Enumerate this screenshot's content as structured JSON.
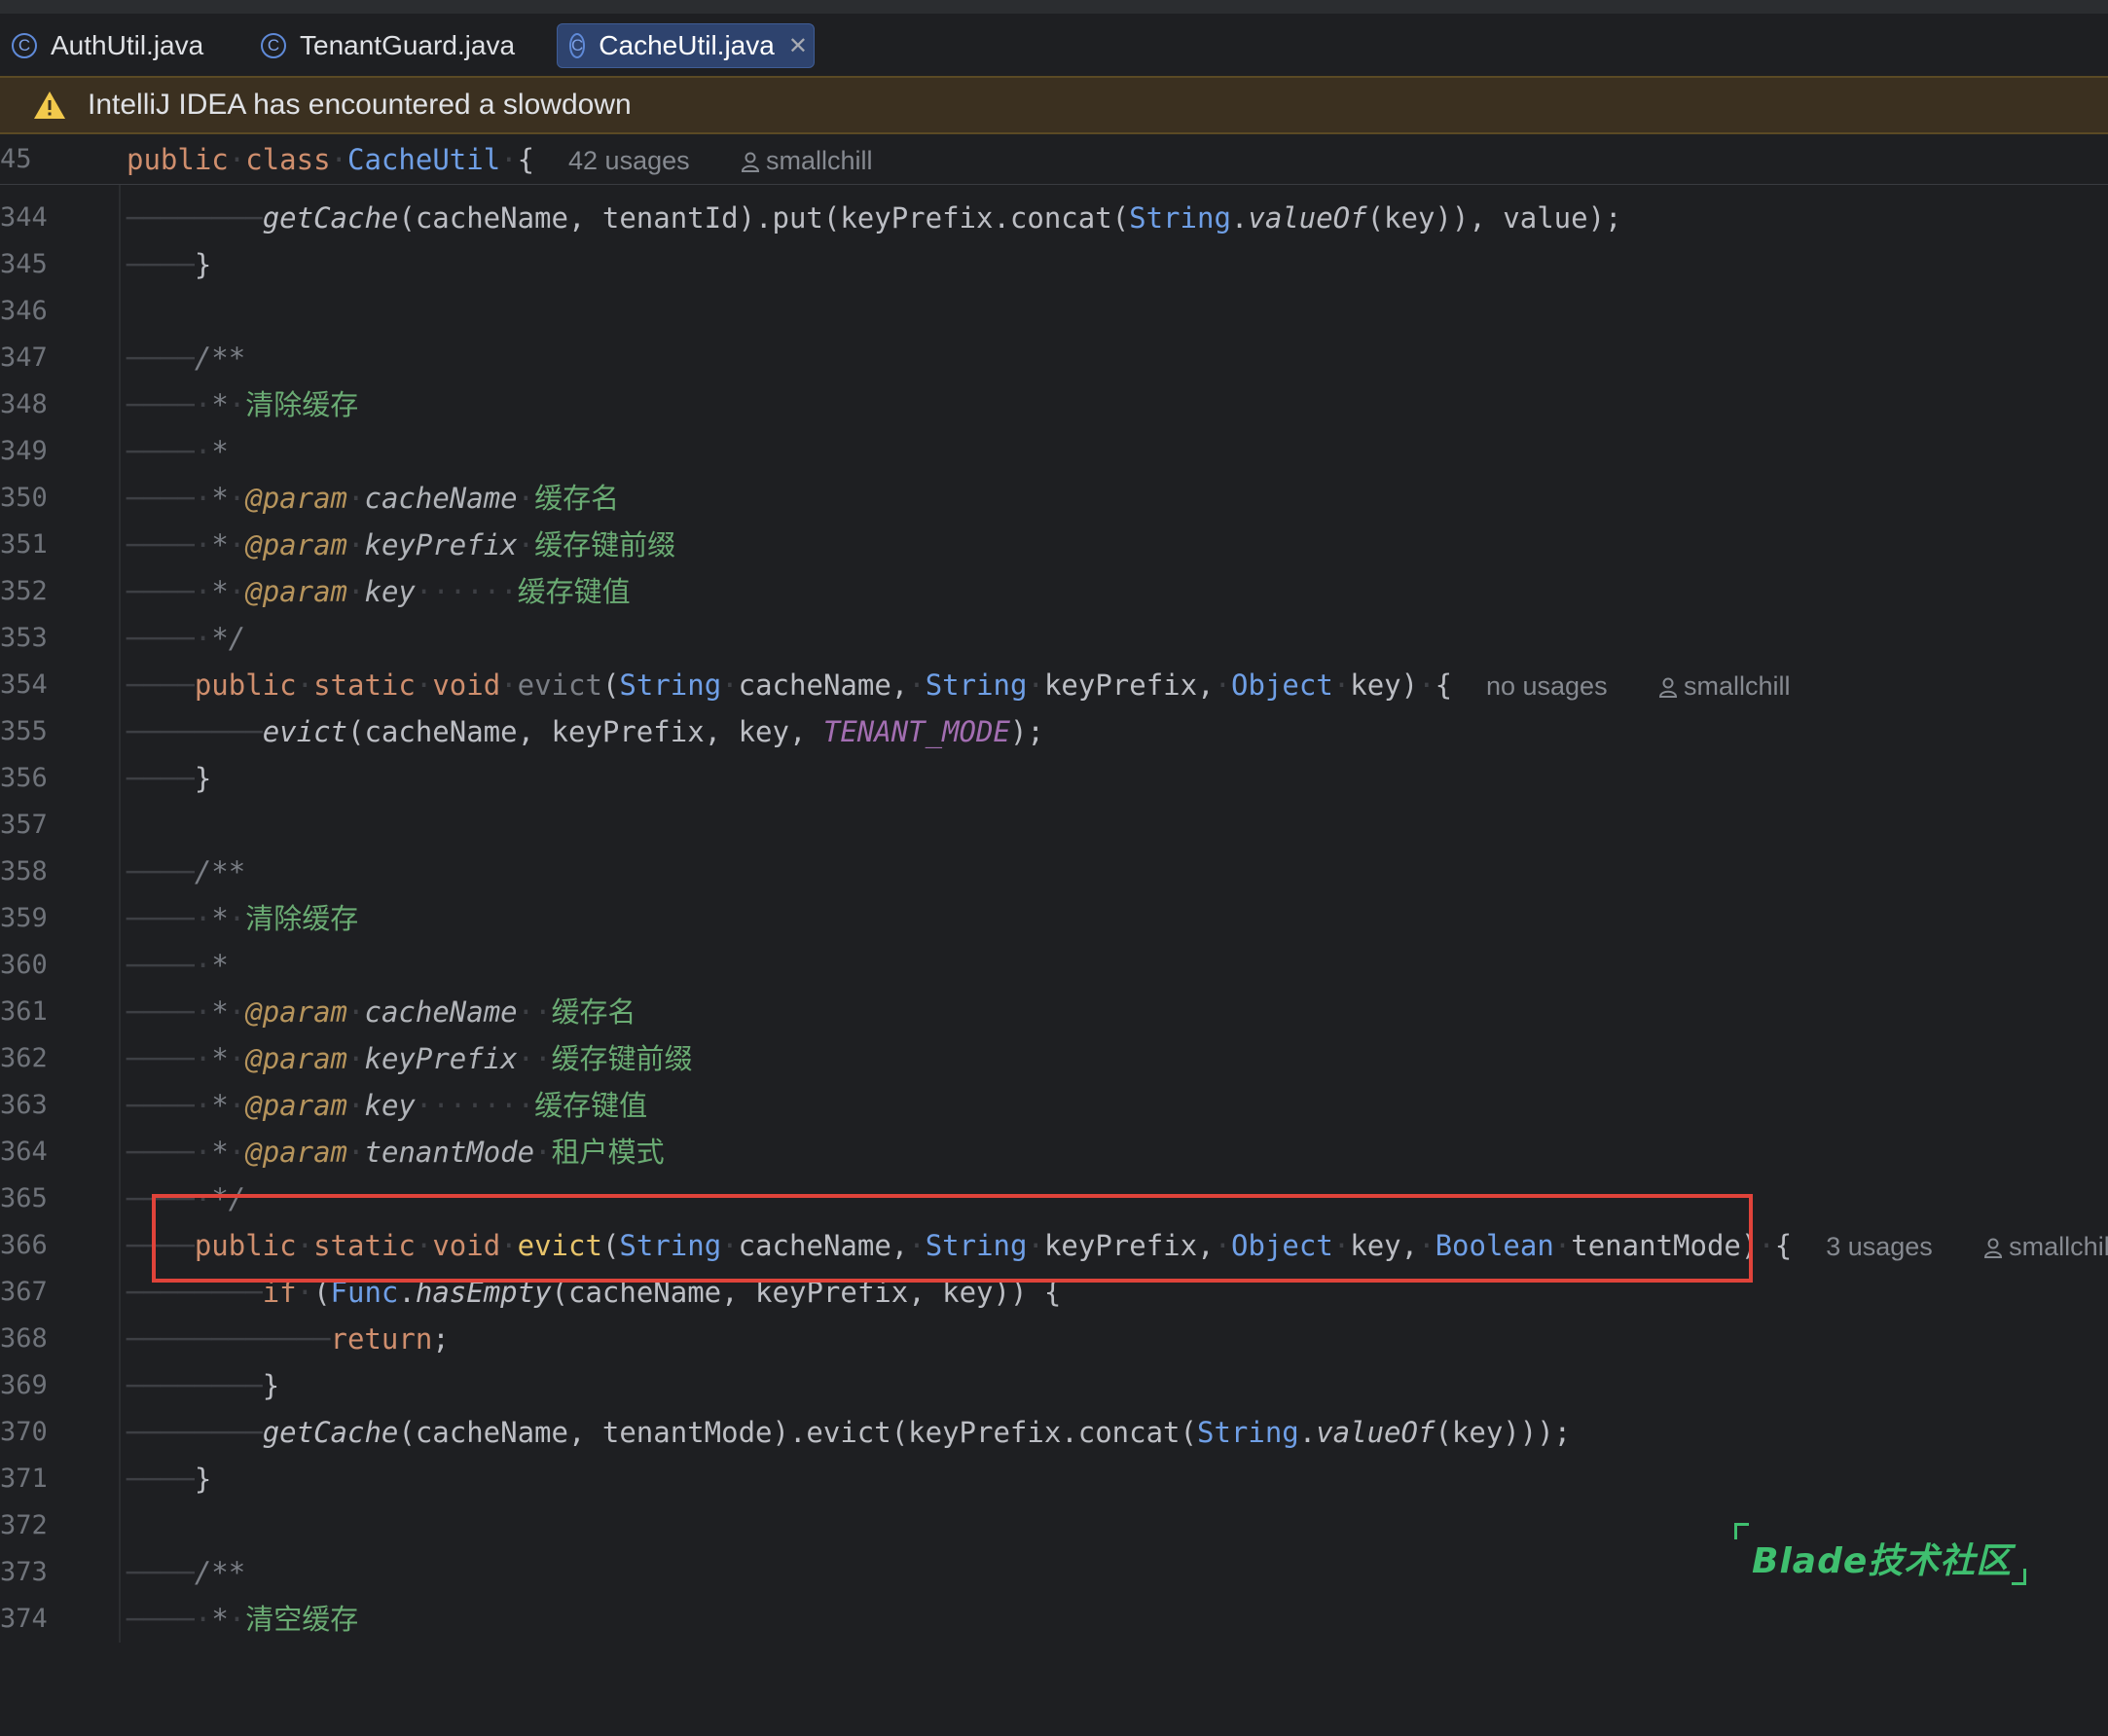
{
  "tabs": [
    {
      "label": "AuthUtil.java",
      "icon": "class-icon",
      "active": false
    },
    {
      "label": "TenantGuard.java",
      "icon": "class-icon",
      "active": false
    },
    {
      "label": "CacheUtil.java",
      "icon": "class-icon",
      "active": true
    }
  ],
  "banner": {
    "text": "IntelliJ IDEA has encountered a slowdown",
    "icon": "warning-icon"
  },
  "sticky": {
    "line_number": "45",
    "kw1": "public",
    "kw2": "class",
    "class_name": "CacheUtil",
    "brace": "{",
    "usages": "42 usages",
    "author": "smallchill"
  },
  "lines": {
    "l344": {
      "num": "344",
      "fn": "getCache",
      "a": "(cacheName, tenantId).put(keyPrefix.concat(",
      "type": "String",
      "dot": ".",
      "m": "valueOf",
      "b": "(key)), value);"
    },
    "l345": {
      "num": "345",
      "t": "}"
    },
    "l346": {
      "num": "346"
    },
    "l347": {
      "num": "347",
      "t": "/**"
    },
    "l348": {
      "num": "348",
      "star": "*",
      "t": "清除缓存"
    },
    "l349": {
      "num": "349",
      "star": "*"
    },
    "l350": {
      "num": "350",
      "star": "*",
      "tag": "@param",
      "p": "cacheName",
      "t": "缓存名"
    },
    "l351": {
      "num": "351",
      "star": "*",
      "tag": "@param",
      "p": "keyPrefix",
      "t": "缓存键前缀"
    },
    "l352": {
      "num": "352",
      "star": "*",
      "tag": "@param",
      "p": "key",
      "dots": "······",
      "t": "缓存键值"
    },
    "l353": {
      "num": "353",
      "t": "*/"
    },
    "l354": {
      "num": "354",
      "kw1": "public",
      "kw2": "static",
      "kw3": "void",
      "name": "evict",
      "open": "(",
      "ty1": "String",
      "p1": "cacheName,",
      "ty2": "String",
      "p2": "keyPrefix,",
      "ty3": "Object",
      "p3": "key)",
      "brace": "{",
      "usages": "no usages",
      "author": "smallchill"
    },
    "l355": {
      "num": "355",
      "fn": "evict",
      "a": "(cacheName, keyPrefix, key, ",
      "const": "TENANT_MODE",
      "b": ");"
    },
    "l356": {
      "num": "356",
      "t": "}"
    },
    "l357": {
      "num": "357"
    },
    "l358": {
      "num": "358",
      "t": "/**"
    },
    "l359": {
      "num": "359",
      "star": "*",
      "t": "清除缓存"
    },
    "l360": {
      "num": "360",
      "star": "*"
    },
    "l361": {
      "num": "361",
      "star": "*",
      "tag": "@param",
      "p": "cacheName",
      "t": "缓存名"
    },
    "l362": {
      "num": "362",
      "star": "*",
      "tag": "@param",
      "p": "keyPrefix",
      "t": "缓存键前缀"
    },
    "l363": {
      "num": "363",
      "star": "*",
      "tag": "@param",
      "p": "key",
      "dots": "······",
      "t": "缓存键值"
    },
    "l364": {
      "num": "364",
      "star": "*",
      "tag": "@param",
      "p": "tenantMode",
      "t": "租户模式"
    },
    "l365": {
      "num": "365",
      "t": "*/"
    },
    "l366": {
      "num": "366",
      "kw1": "public",
      "kw2": "static",
      "kw3": "void",
      "name": "evict",
      "open": "(",
      "ty1": "String",
      "p1": "cacheName,",
      "ty2": "String",
      "p2": "keyPrefix,",
      "ty3": "Object",
      "p3": "key,",
      "ty4": "Boolean",
      "p4": "tenantMode)",
      "brace": "{",
      "usages": "3 usages",
      "author": "smallchill"
    },
    "l367": {
      "num": "367",
      "kw": "if",
      "a": "(",
      "cls": "Func",
      "dot": ".",
      "m": "hasEmpty",
      "b": "(cacheName, keyPrefix, key)) {"
    },
    "l368": {
      "num": "368",
      "kw": "return",
      "b": ";"
    },
    "l369": {
      "num": "369",
      "t": "}"
    },
    "l370": {
      "num": "370",
      "fn": "getCache",
      "a": "(cacheName, tenantMode).evict(keyPrefix.concat(",
      "type": "String",
      "dot": ".",
      "m": "valueOf",
      "b": "(key)));"
    },
    "l371": {
      "num": "371",
      "t": "}"
    },
    "l372": {
      "num": "372"
    },
    "l373": {
      "num": "373",
      "t": "/**"
    },
    "l374": {
      "num": "374",
      "star": "*",
      "t": "清空缓存"
    }
  },
  "watermark": {
    "text": "Blade技术社区"
  },
  "colors": {
    "highlight_box": "#e0433a",
    "keyword": "#cf8e6d",
    "type": "#6f9fe6",
    "comment_text": "#6aab73",
    "watermark": "#3fbf6f"
  }
}
